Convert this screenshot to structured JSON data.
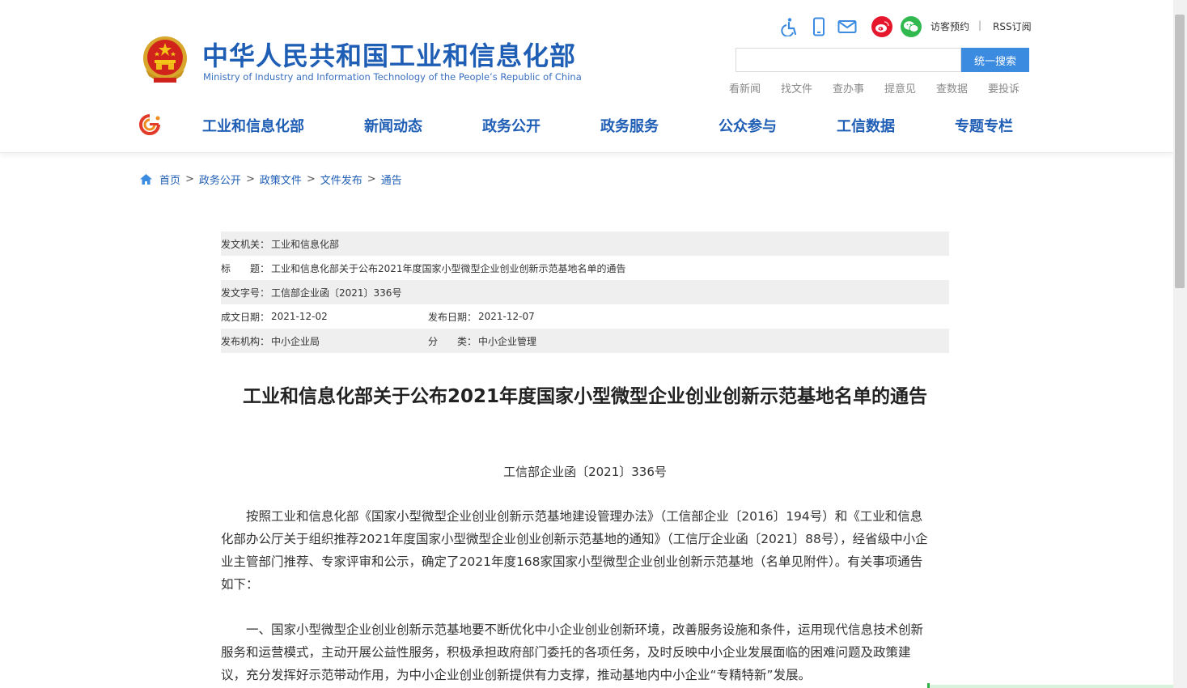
{
  "header": {
    "title_cn": "中华人民共和国工业和信息化部",
    "title_en": "Ministry of Industry and Information Technology of the People’s Republic of China",
    "utility": {
      "icons": [
        "accessibility-icon",
        "mobile-icon",
        "mail-icon",
        "weibo-icon",
        "wechat-icon"
      ],
      "visitor_booking": "访客预约",
      "separator": "|",
      "rss": "RSS订阅"
    },
    "search": {
      "value": "",
      "placeholder": "",
      "button": "统一搜索"
    },
    "quick_links": [
      "看新闻",
      "找文件",
      "查办事",
      "提意见",
      "查数据",
      "要投诉"
    ]
  },
  "nav": {
    "items": [
      "工业和信息化部",
      "新闻动态",
      "政务公开",
      "政务服务",
      "公众参与",
      "工信数据",
      "专题专栏"
    ]
  },
  "breadcrumb": [
    "首页",
    "政务公开",
    "政策文件",
    "文件发布",
    "通告"
  ],
  "breadcrumb_sep": ">",
  "meta": {
    "issuer_label": "发文机关：",
    "issuer": "工业和信息化部",
    "title_label": "标　　题：",
    "title": "工业和信息化部关于公布2021年度国家小型微型企业创业创新示范基地名单的通告",
    "docno_label": "发文字号：",
    "docno": "工信部企业函〔2021〕336号",
    "created_label": "成文日期：",
    "created": "2021-12-02",
    "published_label": "发布日期：",
    "published": "2021-12-07",
    "org_label": "发布机构：",
    "org": "中小企业局",
    "category_label": "分　　类：",
    "category": "中小企业管理"
  },
  "article": {
    "title": "工业和信息化部关于公布2021年度国家小型微型企业创业创新示范基地名单的通告",
    "doc_number": "工信部企业函〔2021〕336号",
    "para1": [
      "　　按照工业和信息化部《国家小型微型企业创业创新示范基地建设管理办法》（工信部企业〔2016〕194号）和《工业和信息",
      "化部办公厅关于组织推荐2021年度国家小型微型企业创业创新示范基地的通知》（工信厅企业函〔2021〕88号），经省级中小企",
      "业主管部门推荐、专家评审和公示，确定了2021年度168家国家小型微型企业创业创新示范基地（名单见附件）。有关事项通告",
      "如下："
    ],
    "para2": [
      "　　一、国家小型微型企业创业创新示范基地要不断优化中小企业创业创新环境，改善服务设施和条件，运用现代信息技术创新",
      "服务和运营模式，主动开展公益性服务，积极承担政府部门委托的各项任务，及时反映中小企业发展面临的困难问题及政策建",
      "议，充分发挥好示范带动作用，为中小企业创业创新提供有力支撑，推动基地内中小企业“专精特新”发展。"
    ]
  },
  "colors": {
    "brand_blue": "#1f5eb5",
    "search_button": "#3b8be0",
    "weibo_red": "#e6162d",
    "wechat_green": "#31b950",
    "meta_row_grey": "#efefef"
  }
}
